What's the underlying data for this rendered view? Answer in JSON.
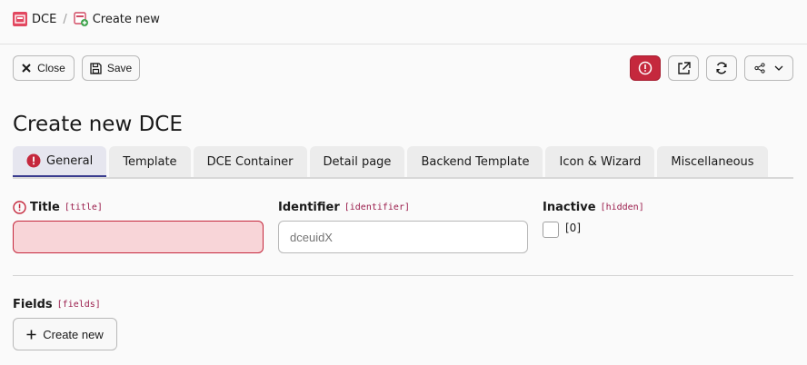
{
  "breadcrumb": {
    "root": "DCE",
    "separator": "/",
    "current": "Create new"
  },
  "toolbar": {
    "close_label": "Close",
    "save_label": "Save"
  },
  "page": {
    "title": "Create new DCE"
  },
  "tabs": [
    {
      "label": "General",
      "active": true,
      "has_error": true
    },
    {
      "label": "Template"
    },
    {
      "label": "DCE Container"
    },
    {
      "label": "Detail page"
    },
    {
      "label": "Backend Template"
    },
    {
      "label": "Icon & Wizard"
    },
    {
      "label": "Miscellaneous"
    }
  ],
  "form": {
    "title": {
      "label": "Title",
      "key": "[title]",
      "value": ""
    },
    "identifier": {
      "label": "Identifier",
      "key": "[identifier]",
      "placeholder": "dceuidX"
    },
    "inactive": {
      "label": "Inactive",
      "key": "[hidden]",
      "checkbox_text": "[0]",
      "checked": false
    },
    "fields": {
      "label": "Fields",
      "key": "[fields]",
      "create_label": "Create new"
    }
  },
  "colors": {
    "accent": "#3a3d8f",
    "error": "#c5283d",
    "error_bg": "#f8d5d8",
    "key_color": "#9a1c4b"
  },
  "icons": [
    "dce-icon",
    "create-new-icon",
    "close-icon",
    "save-icon",
    "alert-icon",
    "open-external-icon",
    "reload-icon",
    "share-icon",
    "chevron-down-icon",
    "error-icon",
    "plus-icon"
  ]
}
